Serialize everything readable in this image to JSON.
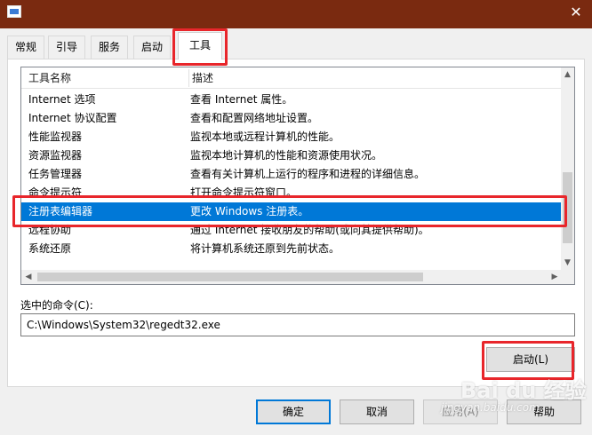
{
  "window": {
    "close_glyph": "✕"
  },
  "tabs": [
    {
      "label": "常规"
    },
    {
      "label": "引导"
    },
    {
      "label": "服务"
    },
    {
      "label": "启动"
    },
    {
      "label": "工具"
    }
  ],
  "active_tab": "工具",
  "tools_list": {
    "columns": [
      "工具名称",
      "描述"
    ],
    "rows": [
      {
        "name": "Internet 选项",
        "desc": "查看 Internet 属性。"
      },
      {
        "name": "Internet 协议配置",
        "desc": "查看和配置网络地址设置。"
      },
      {
        "name": "性能监视器",
        "desc": "监视本地或远程计算机的性能。"
      },
      {
        "name": "资源监视器",
        "desc": "监视本地计算机的性能和资源使用状况。"
      },
      {
        "name": "任务管理器",
        "desc": "查看有关计算机上运行的程序和进程的详细信息。"
      },
      {
        "name": "命令提示符",
        "desc": "打开命令提示符窗口。"
      },
      {
        "name": "注册表编辑器",
        "desc": "更改 Windows 注册表。"
      },
      {
        "name": "远程协助",
        "desc": "通过 Internet 接收朋友的帮助(或向其提供帮助)。"
      },
      {
        "name": "系统还原",
        "desc": "将计算机系统还原到先前状态。"
      }
    ],
    "selected_row": "注册表编辑器"
  },
  "command": {
    "label": "选中的命令(C):",
    "value": "C:\\Windows\\System32\\regedt32.exe"
  },
  "buttons": {
    "launch": "启动(L)",
    "ok": "确定",
    "cancel": "取消",
    "apply": "应用(A)",
    "help": "帮助"
  },
  "watermark": {
    "logo": "Bai du 经验",
    "url": "jingyan.baidu.com"
  },
  "colors": {
    "title_bar": "#7a2a10",
    "selection": "#0078d7",
    "annotation": "#e8262b"
  }
}
